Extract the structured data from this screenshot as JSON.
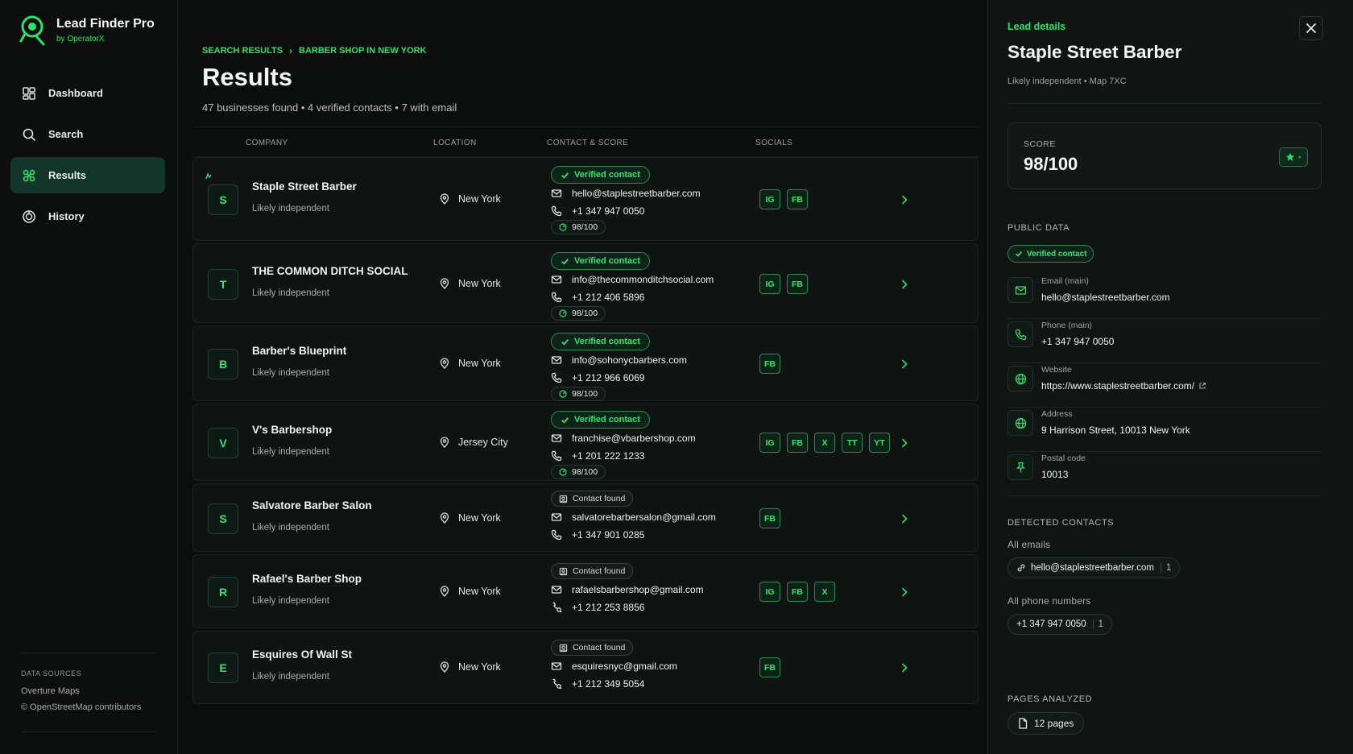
{
  "brand": {
    "name": "Lead Finder Pro",
    "by": "by OperatorX"
  },
  "nav": [
    {
      "label": "Dashboard",
      "icon": "dashboard-icon"
    },
    {
      "label": "Search",
      "icon": "search-icon"
    },
    {
      "label": "Results",
      "icon": "results-icon",
      "active": true
    },
    {
      "label": "History",
      "icon": "history-icon"
    }
  ],
  "sources": {
    "title": "DATA SOURCES",
    "line1": "Overture Maps",
    "line2": "© OpenStreetMap contributors"
  },
  "breadcrumb": {
    "root": "SEARCH RESULTS",
    "sep": "›",
    "current": "BARBER SHOP IN NEW YORK"
  },
  "main": {
    "title": "Results",
    "subtitle": "47 businesses found • 4 verified contacts • 7 with email"
  },
  "columns": {
    "company": "COMPANY",
    "location": "LOCATION",
    "contact": "CONTACT & SCORE",
    "socials": "SOCIALS"
  },
  "rows": [
    {
      "initial": "S",
      "name": "Staple Street Barber",
      "sub": "Likely independent",
      "location": "New York",
      "status": "Verified contact",
      "email": "hello@staplestreetbarber.com",
      "phone": "+1 347 947 0050",
      "score": "98/100",
      "socials": [
        "IG",
        "FB"
      ]
    },
    {
      "initial": "T",
      "name": "THE COMMON DITCH SOCIAL",
      "sub": "Likely independent",
      "location": "New York",
      "status": "Verified contact",
      "email": "info@thecommonditchsocial.com",
      "phone": "+1 212 406 5896",
      "score": "98/100",
      "socials": [
        "IG",
        "FB"
      ]
    },
    {
      "initial": "B",
      "name": "Barber's Blueprint",
      "sub": "Likely independent",
      "location": "New York",
      "status": "Verified contact",
      "email": "info@sohonycbarbers.com",
      "phone": "+1 212 966 6069",
      "score": "98/100",
      "socials": [
        "FB"
      ]
    },
    {
      "initial": "V",
      "name": "V's Barbershop",
      "sub": "Likely independent",
      "location": "Jersey City",
      "status": "Verified contact",
      "email": "franchise@vbarbershop.com",
      "phone": "+1 201 222 1233",
      "score": "98/100",
      "socials": [
        "IG",
        "FB",
        "X",
        "TT",
        "YT"
      ]
    },
    {
      "initial": "S",
      "name": "Salvatore Barber Salon",
      "sub": "Likely independent",
      "location": "New York",
      "status": "Contact found",
      "email": "salvatorebarbersalon@gmail.com",
      "phone": "+1 347 901 0285",
      "socials": [
        "FB"
      ]
    },
    {
      "initial": "R",
      "name": "Rafael's Barber Shop",
      "sub": "Likely independent",
      "location": "New York",
      "status": "Contact found",
      "email": "rafaelsbarbershop@gmail.com",
      "phone": "+1 212 253 8856",
      "socials": [
        "IG",
        "FB",
        "X"
      ]
    },
    {
      "initial": "E",
      "name": "Esquires Of Wall St",
      "sub": "Likely independent",
      "location": "New York",
      "status": "Contact found",
      "email": "esquiresnyc@gmail.com",
      "phone": "+1 212 349 5054",
      "socials": [
        "FB"
      ]
    }
  ],
  "details": {
    "kicker": "Lead details",
    "title": "Staple Street Barber",
    "subtitle": "Likely independent • Map 7XC",
    "score_label": "SCORE",
    "score_value": "98/100",
    "public_title": "PUBLIC DATA",
    "verified": "Verified contact",
    "fields": [
      {
        "label": "Email (main)",
        "value": "hello@staplestreetbarber.com",
        "icon": "mail-icon"
      },
      {
        "label": "Phone (main)",
        "value": "+1 347 947 0050",
        "icon": "phone-icon"
      },
      {
        "label": "Website",
        "value": "https://www.staplestreetbarber.com/",
        "icon": "globe-icon"
      },
      {
        "label": "Address",
        "value": "9 Harrison Street, 10013 New York",
        "icon": "globe-icon"
      },
      {
        "label": "Postal code",
        "value": "10013",
        "icon": "pin-icon"
      }
    ],
    "detected_title": "DETECTED CONTACTS",
    "emails_title": "All emails",
    "email_chip": "hello@staplestreetbarber.com",
    "email_count": "1",
    "phones_title": "All phone numbers",
    "phone_chip": "+1 347 947 0050",
    "phone_count": "1",
    "pages_title": "PAGES ANALYZED",
    "pages": "12 pages"
  },
  "colors": {
    "accent": "#2ee06b",
    "background": "#0b0e0d",
    "panel": "#101413"
  }
}
